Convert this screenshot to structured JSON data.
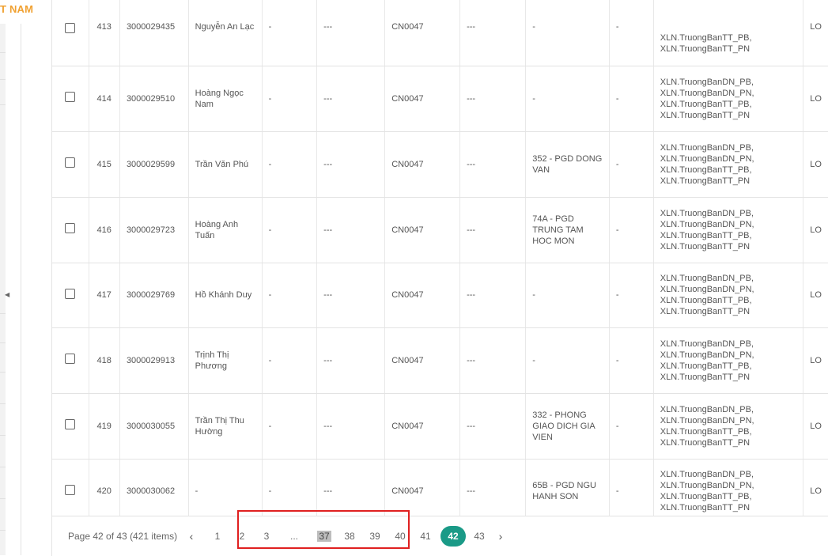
{
  "brand": "T NAM",
  "table": {
    "rows": [
      {
        "stt": "413",
        "code": "3000029435",
        "name": "Nguyễn An Lạc",
        "c4": "-",
        "c5": "---",
        "branch": "CN0047",
        "c7": "---",
        "unit": "-",
        "c9": "-",
        "roles": "XLN.TruongBanTT_PB,\nXLN.TruongBanTT_PN",
        "last": "LO"
      },
      {
        "stt": "414",
        "code": "3000029510",
        "name": "Hoàng Ngọc Nam",
        "c4": "-",
        "c5": "---",
        "branch": "CN0047",
        "c7": "---",
        "unit": "-",
        "c9": "-",
        "roles": "XLN.TruongBanDN_PB,\nXLN.TruongBanDN_PN,\nXLN.TruongBanTT_PB,\nXLN.TruongBanTT_PN",
        "last": "LO"
      },
      {
        "stt": "415",
        "code": "3000029599",
        "name": "Trần Văn Phú",
        "c4": "-",
        "c5": "---",
        "branch": "CN0047",
        "c7": "---",
        "unit": "352 - PGD DONG VAN",
        "c9": "-",
        "roles": "XLN.TruongBanDN_PB,\nXLN.TruongBanDN_PN,\nXLN.TruongBanTT_PB,\nXLN.TruongBanTT_PN",
        "last": "LO"
      },
      {
        "stt": "416",
        "code": "3000029723",
        "name": "Hoàng Anh Tuấn",
        "c4": "-",
        "c5": "---",
        "branch": "CN0047",
        "c7": "---",
        "unit": "74A - PGD TRUNG TAM HOC MON",
        "c9": "-",
        "roles": "XLN.TruongBanDN_PB,\nXLN.TruongBanDN_PN,\nXLN.TruongBanTT_PB,\nXLN.TruongBanTT_PN",
        "last": "LO"
      },
      {
        "stt": "417",
        "code": "3000029769",
        "name": "Hồ Khánh Duy",
        "c4": "-",
        "c5": "---",
        "branch": "CN0047",
        "c7": "---",
        "unit": "-",
        "c9": "-",
        "roles": "XLN.TruongBanDN_PB,\nXLN.TruongBanDN_PN,\nXLN.TruongBanTT_PB,\nXLN.TruongBanTT_PN",
        "last": "LO"
      },
      {
        "stt": "418",
        "code": "3000029913",
        "name": "Trịnh Thị Phương",
        "c4": "-",
        "c5": "---",
        "branch": "CN0047",
        "c7": "---",
        "unit": "-",
        "c9": "-",
        "roles": "XLN.TruongBanDN_PB,\nXLN.TruongBanDN_PN,\nXLN.TruongBanTT_PB,\nXLN.TruongBanTT_PN",
        "last": "LO"
      },
      {
        "stt": "419",
        "code": "3000030055",
        "name": "Trần Thị Thu Hường",
        "c4": "-",
        "c5": "---",
        "branch": "CN0047",
        "c7": "---",
        "unit": "332 - PHONG GIAO DICH GIA VIEN",
        "c9": "-",
        "roles": "XLN.TruongBanDN_PB,\nXLN.TruongBanDN_PN,\nXLN.TruongBanTT_PB,\nXLN.TruongBanTT_PN",
        "last": "LO"
      },
      {
        "stt": "420",
        "code": "3000030062",
        "name": "-",
        "c4": "-",
        "c5": "---",
        "branch": "CN0047",
        "c7": "---",
        "unit": "65B - PGD NGU HANH SON",
        "c9": "-",
        "roles": "XLN.TruongBanDN_PB,\nXLN.TruongBanDN_PN,\nXLN.TruongBanTT_PB,\nXLN.TruongBanTT_PN",
        "last": "LO"
      }
    ]
  },
  "pagination": {
    "info": "Page 42 of 43 (421 items)",
    "prev_icon": "chevron-left-icon",
    "next_icon": "chevron-right-icon",
    "prev_glyph": "‹",
    "next_glyph": "›",
    "pages": [
      "1",
      "2",
      "3",
      "...",
      "37",
      "38",
      "39",
      "40",
      "41",
      "42",
      "43"
    ],
    "current": "42",
    "highlighted_text": "37",
    "active_color": "#1a9a87",
    "annotation_color": "#e02020"
  }
}
